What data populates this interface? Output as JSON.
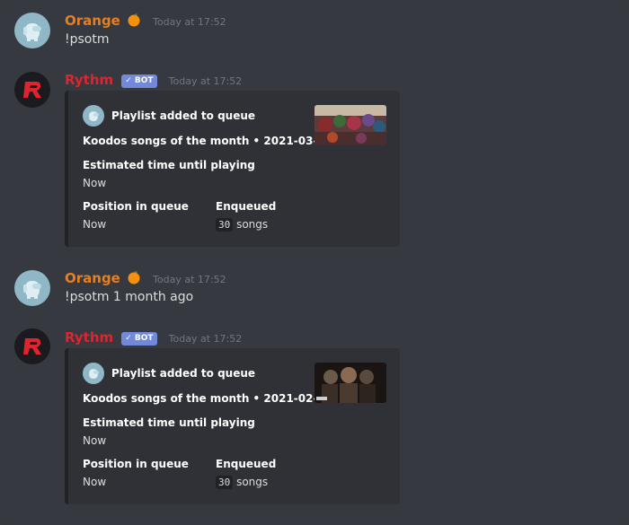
{
  "messages": [
    {
      "author": "Orange",
      "timestamp": "Today at 17:52",
      "text": "!psotm"
    },
    {
      "author": "Rythm",
      "bot_tag": "✓ BOT",
      "timestamp": "Today at 17:52",
      "embed": {
        "author": "Playlist added to queue",
        "title": "Koodos songs of the month • 2021-03-12",
        "fields": {
          "est_name": "Estimated time until playing",
          "est_value": "Now",
          "pos_name": "Position in queue",
          "pos_value": "Now",
          "enq_name": "Enqueued",
          "enq_count": "30",
          "enq_unit": "songs"
        }
      }
    },
    {
      "author": "Orange",
      "timestamp": "Today at 17:52",
      "text": "!psotm 1 month ago"
    },
    {
      "author": "Rythm",
      "bot_tag": "✓ BOT",
      "timestamp": "Today at 17:52",
      "embed": {
        "author": "Playlist added to queue",
        "title": "Koodos songs of the month • 2021-02-13",
        "fields": {
          "est_name": "Estimated time until playing",
          "est_value": "Now",
          "pos_name": "Position in queue",
          "pos_value": "Now",
          "enq_name": "Enqueued",
          "enq_count": "30",
          "enq_unit": "songs"
        }
      }
    }
  ],
  "colors": {
    "background": "#36393f",
    "embed_bg": "#2f3136",
    "orange_username": "#e67e22",
    "rythm_username": "#e0242f",
    "bot_tag": "#7289da"
  },
  "icons": {
    "orange_avatar": "among-us-crewmate-avatar",
    "rythm_avatar": "rythm-logo-avatar",
    "orange_emoji": "orange-fruit-icon"
  }
}
